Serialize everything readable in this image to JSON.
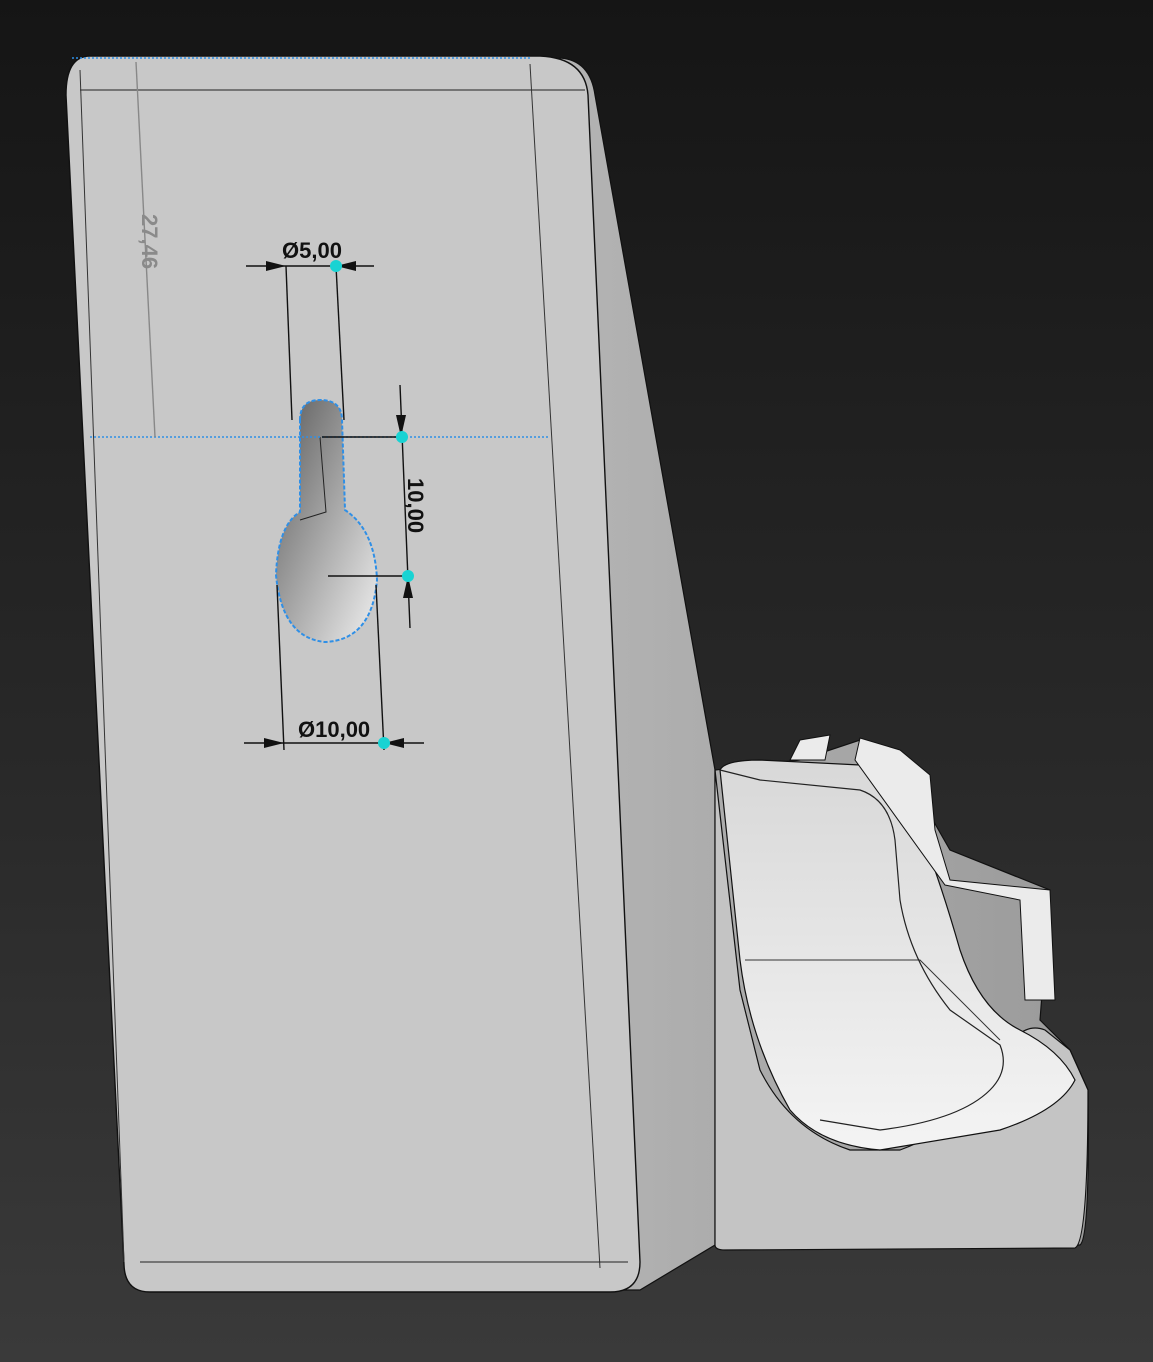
{
  "viewport": {
    "background_top": "#151515",
    "background_bottom": "#3a3a3a",
    "part_color": "#c8c8c8",
    "sketch_color": "#2f8fe6",
    "point_color": "#19d3d3"
  },
  "dimensions": {
    "vertical_offset": "27,46",
    "slot_diameter": "Ø5,00",
    "center_distance": "10,00",
    "hole_diameter": "Ø10,00"
  }
}
